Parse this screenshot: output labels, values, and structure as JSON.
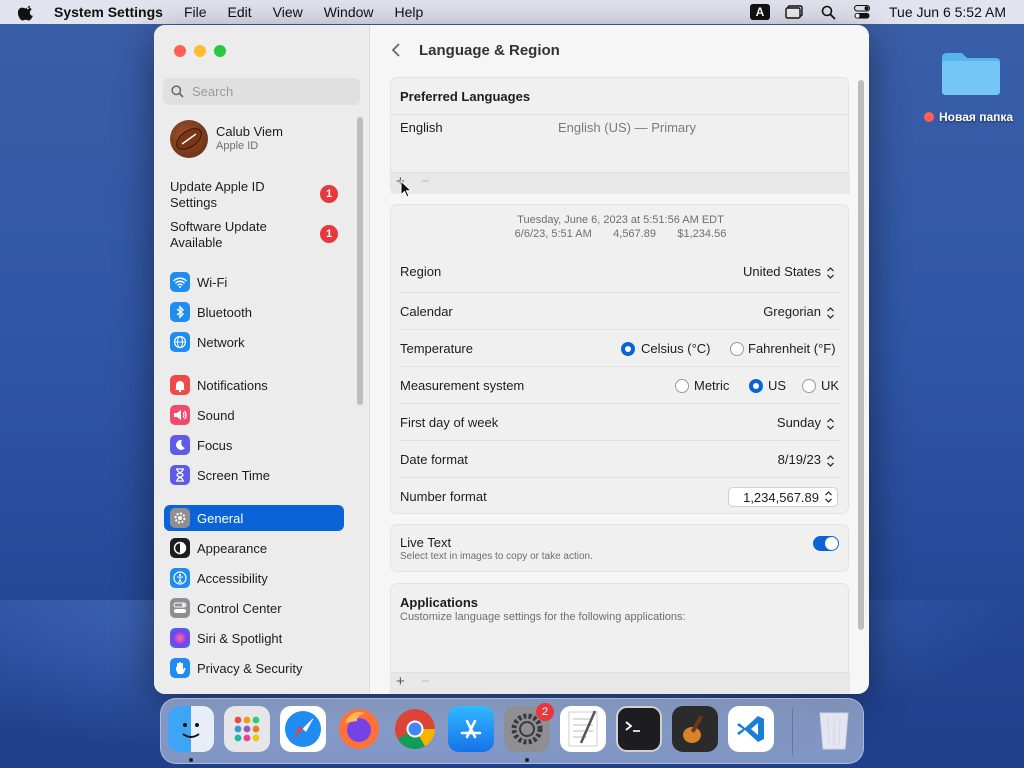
{
  "menubar": {
    "app_name": "System Settings",
    "menus": [
      "File",
      "Edit",
      "View",
      "Window",
      "Help"
    ],
    "input_indicator": "A",
    "clock": "Tue Jun 6  5:52 AM"
  },
  "desktop": {
    "folder_label": "Новая папка"
  },
  "window": {
    "search_placeholder": "Search",
    "account": {
      "name": "Calub Viem",
      "subtitle": "Apple ID"
    },
    "notices": [
      {
        "label": "Update Apple ID Settings",
        "badge": "1"
      },
      {
        "label": "Software Update Available",
        "badge": "1"
      }
    ],
    "sidebar_items": [
      {
        "label": "Wi-Fi",
        "icon": "wifi-icon",
        "color": "#1e8cf0"
      },
      {
        "label": "Bluetooth",
        "icon": "bluetooth-icon",
        "color": "#1e8cf0"
      },
      {
        "label": "Network",
        "icon": "globe-icon",
        "color": "#1e8cf0"
      },
      {
        "label": "Notifications",
        "icon": "bell-icon",
        "color": "#ef4b48"
      },
      {
        "label": "Sound",
        "icon": "speaker-icon",
        "color": "#ef4b6a"
      },
      {
        "label": "Focus",
        "icon": "moon-icon",
        "color": "#5e5ce6"
      },
      {
        "label": "Screen Time",
        "icon": "hourglass-icon",
        "color": "#5e5ce6"
      },
      {
        "label": "General",
        "icon": "gear-icon",
        "color": "#8e8e93",
        "active": true
      },
      {
        "label": "Appearance",
        "icon": "appearance-icon",
        "color": "#1d1d1f"
      },
      {
        "label": "Accessibility",
        "icon": "accessibility-icon",
        "color": "#1e8cf0"
      },
      {
        "label": "Control Center",
        "icon": "toggles-icon",
        "color": "#8e8e93"
      },
      {
        "label": "Siri & Spotlight",
        "icon": "siri-icon",
        "color": "#c145d6"
      },
      {
        "label": "Privacy & Security",
        "icon": "hand-icon",
        "color": "#1e8cf0"
      }
    ]
  },
  "main": {
    "title": "Language & Region",
    "preferred_languages": {
      "title": "Preferred Languages",
      "language": "English",
      "detail": "English (US) — Primary",
      "add": "+",
      "remove": "−"
    },
    "preview": {
      "date_line": "Tuesday, June 6, 2023 at 5:51:56 AM EDT",
      "short_date": "6/6/23, 5:51 AM",
      "number": "4,567.89",
      "currency": "$1,234.56"
    },
    "settings": {
      "region_label": "Region",
      "region_value": "United States",
      "calendar_label": "Calendar",
      "calendar_value": "Gregorian",
      "temperature_label": "Temperature",
      "temp_c": "Celsius (°C)",
      "temp_f": "Fahrenheit (°F)",
      "measurement_label": "Measurement system",
      "metric": "Metric",
      "us": "US",
      "uk": "UK",
      "firstday_label": "First day of week",
      "firstday_value": "Sunday",
      "dateformat_label": "Date format",
      "dateformat_value": "8/19/23",
      "numberformat_label": "Number format",
      "numberformat_value": "1,234,567.89"
    },
    "live_text": {
      "title": "Live Text",
      "subtitle": "Select text in images to copy or take action.",
      "enabled": true
    },
    "applications": {
      "title": "Applications",
      "subtitle": "Customize language settings for the following applications:",
      "add": "+",
      "remove": "−"
    }
  },
  "dock": {
    "apps": [
      "Finder",
      "Launchpad",
      "Safari",
      "Firefox",
      "Chrome",
      "App Store",
      "System Settings",
      "TextEdit",
      "Terminal",
      "GarageBand",
      "Visual Studio Code",
      "Trash"
    ],
    "settings_badge": "2"
  }
}
